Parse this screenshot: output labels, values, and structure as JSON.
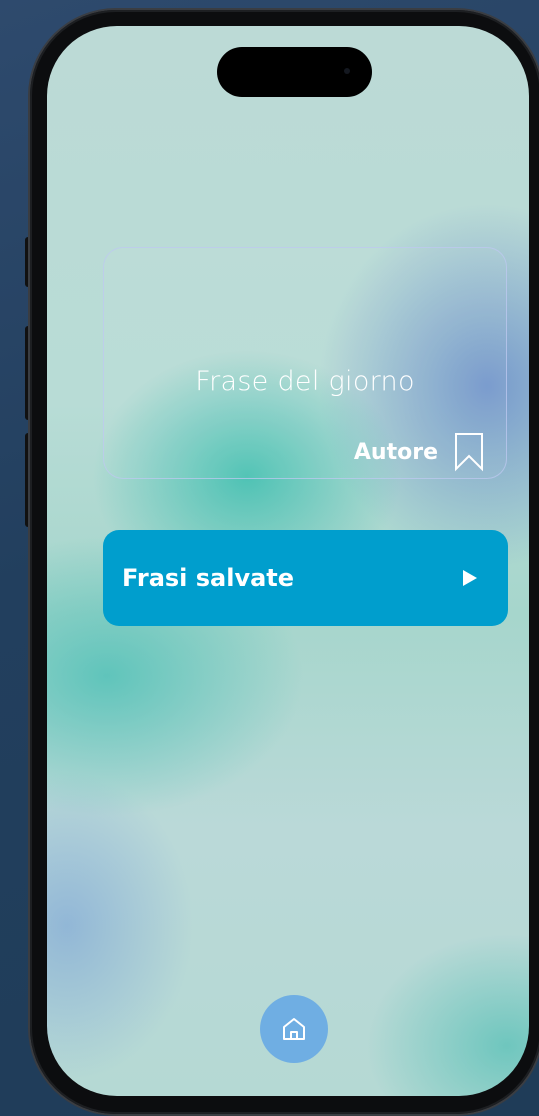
{
  "quote_card": {
    "phrase": "Frase del giorno",
    "author": "Autore",
    "bookmark_icon": "bookmark-icon"
  },
  "saved_phrases": {
    "label": "Frasi salvate",
    "arrow_icon": "play-arrow-icon"
  },
  "bottom_nav": {
    "home_icon": "home-icon"
  },
  "colors": {
    "primary_button": "#009ecd",
    "home_button": "#6faee3",
    "text": "#ffffff",
    "card_border": "#bec8f0"
  }
}
